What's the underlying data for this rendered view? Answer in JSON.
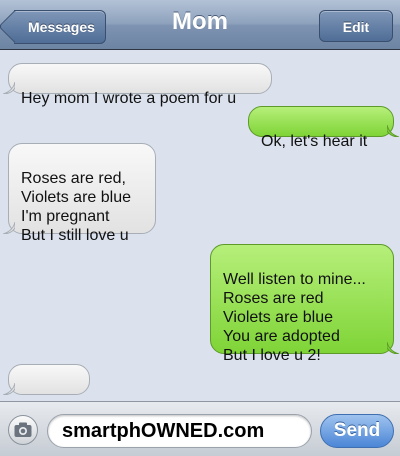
{
  "navbar": {
    "back_label": "Messages",
    "title": "Mom",
    "edit_label": "Edit"
  },
  "messages": [
    {
      "direction": "incoming",
      "text": "Hey mom I wrote a poem for u"
    },
    {
      "direction": "outgoing",
      "text": "Ok, let's hear it"
    },
    {
      "direction": "incoming",
      "text": "Roses are red,\nViolets are blue\nI'm pregnant\nBut I still love u"
    },
    {
      "direction": "outgoing",
      "text": "Well listen to mine...\nRoses are red\nViolets are blue\nYou are adopted\nBut I love u 2!"
    },
    {
      "direction": "incoming",
      "text": "..............."
    }
  ],
  "composer": {
    "input_value": "smartphOWNED.com",
    "send_label": "Send",
    "camera_icon": "camera-icon"
  },
  "colors": {
    "incoming_bubble": "#e9e9e9",
    "outgoing_bubble": "#8ad940",
    "navbar": "#8ea2bd",
    "send_button": "#4b86d6"
  }
}
